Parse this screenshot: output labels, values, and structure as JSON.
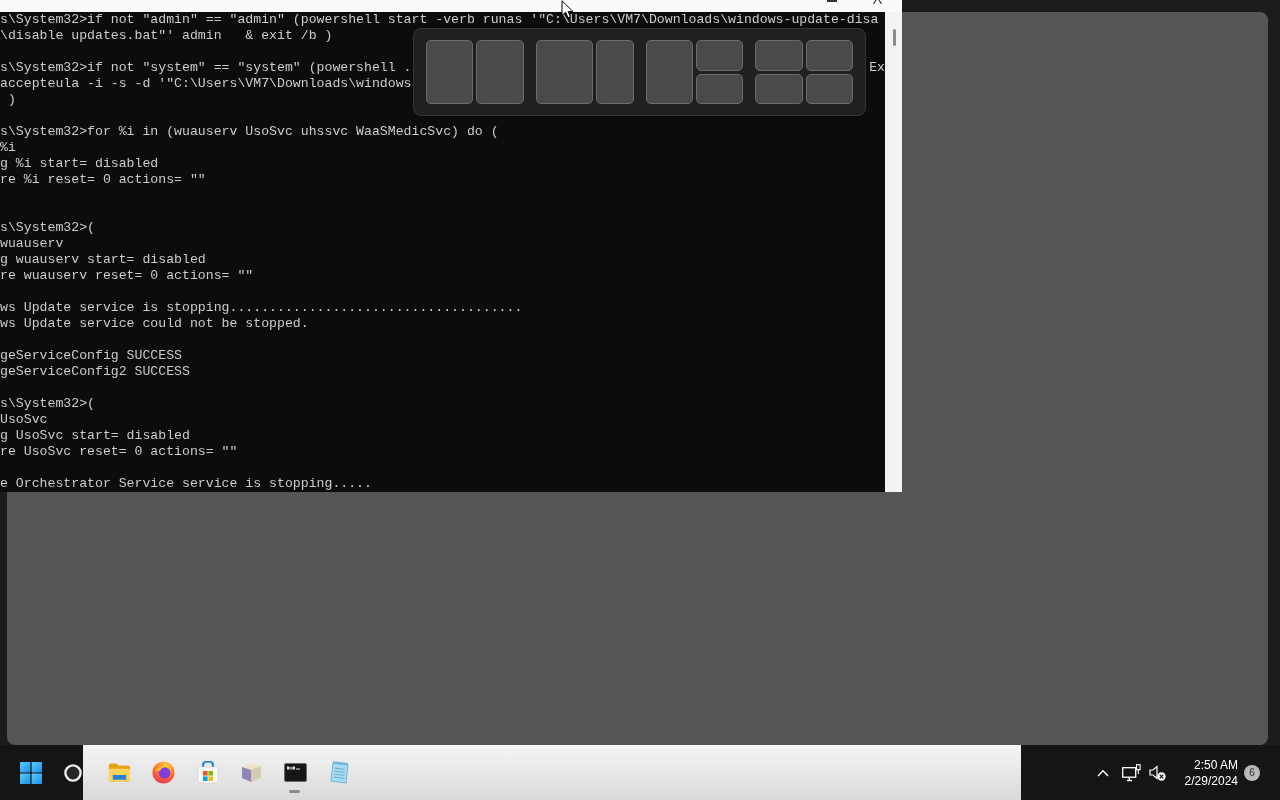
{
  "terminal_window": {
    "lines": [
      {
        "kind": "text",
        "text": "s\\System32>if not \"admin\" == \"admin\" (powershell start -verb runas '\"C:\\Users\\VM7\\Downloads\\windows-update-disa"
      },
      {
        "kind": "text",
        "text": "\\disable updates.bat\"' admin   & exit /b )"
      },
      {
        "kind": "blank"
      },
      {
        "kind": "text",
        "text": "s\\System32>if not \"system\" == \"system\" (powershell .",
        "tail": "Ex"
      },
      {
        "kind": "text",
        "text": "accepteula -i -s -d '\"C:\\Users\\VM7\\Downloads\\windows"
      },
      {
        "kind": "text",
        "text": " )"
      },
      {
        "kind": "blank"
      },
      {
        "kind": "text",
        "text": "s\\System32>for %i in (wuauserv UsoSvc uhssvc WaaSMedicSvc) do ("
      },
      {
        "kind": "text",
        "text": "%i"
      },
      {
        "kind": "text",
        "text": "g %i start= disabled"
      },
      {
        "kind": "text",
        "text": "re %i reset= 0 actions= \"\""
      },
      {
        "kind": "blank"
      },
      {
        "kind": "blank"
      },
      {
        "kind": "text",
        "text": "s\\System32>("
      },
      {
        "kind": "text",
        "text": "wuauserv"
      },
      {
        "kind": "text",
        "text": "g wuauserv start= disabled"
      },
      {
        "kind": "text",
        "text": "re wuauserv reset= 0 actions= \"\""
      },
      {
        "kind": "blank"
      },
      {
        "kind": "text",
        "text": "ws Update service is stopping....................................."
      },
      {
        "kind": "text",
        "text": "ws Update service could not be stopped."
      },
      {
        "kind": "blank"
      },
      {
        "kind": "text",
        "text": "geServiceConfig SUCCESS"
      },
      {
        "kind": "text",
        "text": "geServiceConfig2 SUCCESS"
      },
      {
        "kind": "blank"
      },
      {
        "kind": "text",
        "text": "s\\System32>("
      },
      {
        "kind": "text",
        "text": "UsoSvc"
      },
      {
        "kind": "text",
        "text": "g UsoSvc start= disabled"
      },
      {
        "kind": "text",
        "text": "re UsoSvc reset= 0 actions= \"\""
      },
      {
        "kind": "blank"
      },
      {
        "kind": "text",
        "text": "e Orchestrator Service service is stopping....."
      }
    ]
  },
  "snap_layouts": [
    {
      "kind": "halves"
    },
    {
      "kind": "two-thirds-left"
    },
    {
      "kind": "left-half-right-stacked"
    },
    {
      "kind": "quadrants"
    }
  ],
  "taskbar": {
    "apps": [
      {
        "kind": "folder",
        "running": false
      },
      {
        "kind": "globe",
        "running": false
      },
      {
        "kind": "bag",
        "running": false
      },
      {
        "kind": "cube",
        "running": false
      },
      {
        "kind": "terminal",
        "running": true
      },
      {
        "kind": "notepad",
        "running": false
      }
    ],
    "tray": {
      "volume_muted": true,
      "time": "2:50 AM",
      "date": "2/29/2024",
      "notification_count": "6"
    }
  }
}
